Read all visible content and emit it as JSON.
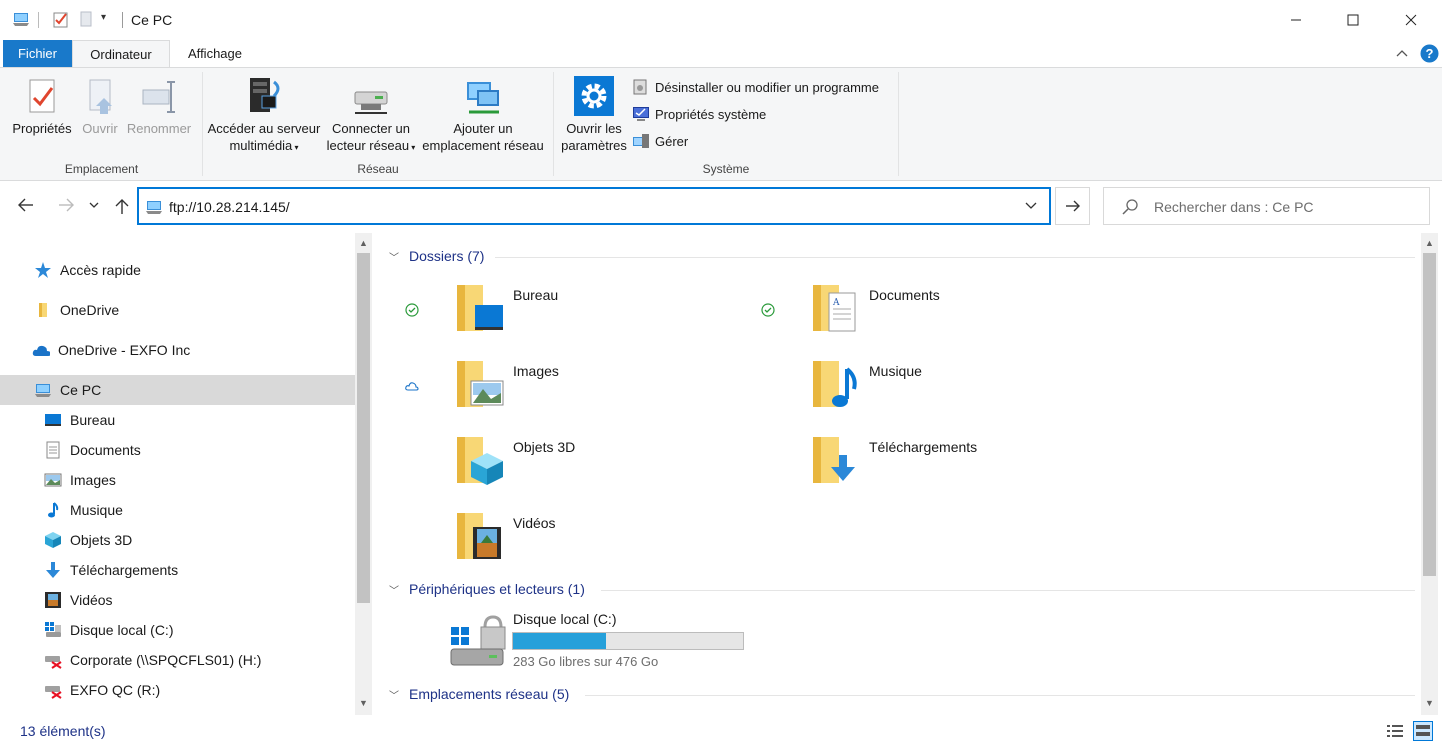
{
  "window": {
    "title": "Ce PC"
  },
  "tabs": [
    {
      "label": "Fichier"
    },
    {
      "label": "Ordinateur"
    },
    {
      "label": "Affichage"
    }
  ],
  "ribbon": {
    "location": {
      "group_label": "Emplacement",
      "properties": "Propriétés",
      "open": "Ouvrir",
      "rename": "Renommer"
    },
    "network": {
      "group_label": "Réseau",
      "media_line1": "Accéder au serveur",
      "media_line2": "multimédia",
      "map_line1": "Connecter un",
      "map_line2": "lecteur réseau",
      "add_line1": "Ajouter un",
      "add_line2": "emplacement réseau"
    },
    "system": {
      "group_label": "Système",
      "settings_line1": "Ouvrir les",
      "settings_line2": "paramètres",
      "uninstall": "Désinstaller ou modifier un programme",
      "sysprops": "Propriétés système",
      "manage": "Gérer"
    }
  },
  "address": {
    "value": "ftp://10.28.214.145/"
  },
  "search": {
    "placeholder": "Rechercher dans : Ce PC"
  },
  "nav": {
    "items": [
      {
        "label": "Accès rapide"
      },
      {
        "label": "OneDrive"
      },
      {
        "label": "OneDrive - EXFO Inc"
      },
      {
        "label": "Ce PC"
      },
      {
        "label": "Bureau"
      },
      {
        "label": "Documents"
      },
      {
        "label": "Images"
      },
      {
        "label": "Musique"
      },
      {
        "label": "Objets 3D"
      },
      {
        "label": "Téléchargements"
      },
      {
        "label": "Vidéos"
      },
      {
        "label": "Disque local (C:)"
      },
      {
        "label": "Corporate (\\\\SPQCFLS01) (H:)"
      },
      {
        "label": "EXFO QC (R:)"
      }
    ]
  },
  "content": {
    "folders_header": "Dossiers (7)",
    "folders": [
      {
        "name": "Bureau"
      },
      {
        "name": "Documents"
      },
      {
        "name": "Images"
      },
      {
        "name": "Musique"
      },
      {
        "name": "Objets 3D"
      },
      {
        "name": "Téléchargements"
      },
      {
        "name": "Vidéos"
      }
    ],
    "devices_header": "Périphériques et lecteurs (1)",
    "drive": {
      "name": "Disque local (C:)",
      "free_text": "283 Go libres sur 476 Go",
      "used_fraction": 0.405
    },
    "network_header": "Emplacements réseau (5)"
  },
  "status": {
    "count": "13 élément(s)"
  },
  "colors": {
    "accent": "#0078d7",
    "file_tab": "#1979ca",
    "header_text": "#1e3287",
    "drive_bar": "#26a0da"
  }
}
